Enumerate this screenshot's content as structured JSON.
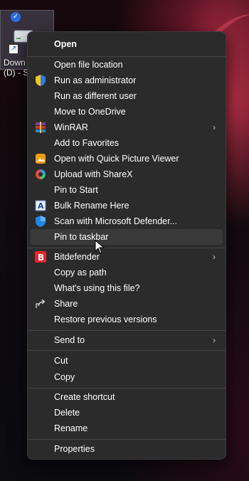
{
  "desktop": {
    "icon_label_line1": "Down",
    "icon_label_line2": "(D) - Sh"
  },
  "menu": {
    "items": [
      {
        "label": "Open",
        "icon": "",
        "bold": true
      },
      {
        "label": "Open file location",
        "icon": ""
      },
      {
        "label": "Run as administrator",
        "icon": "uac-shield-icon"
      },
      {
        "label": "Run as different user",
        "icon": ""
      },
      {
        "label": "Move to OneDrive",
        "icon": ""
      },
      {
        "label": "WinRAR",
        "icon": "winrar-icon",
        "submenu": true
      },
      {
        "label": "Add to Favorites",
        "icon": ""
      },
      {
        "label": "Open with Quick Picture Viewer",
        "icon": "quick-picture-viewer-icon"
      },
      {
        "label": "Upload with ShareX",
        "icon": "sharex-icon"
      },
      {
        "label": "Pin to Start",
        "icon": ""
      },
      {
        "label": "Bulk Rename Here",
        "icon": "bulk-rename-icon"
      },
      {
        "label": "Scan with Microsoft Defender...",
        "icon": "defender-icon"
      },
      {
        "label": "Pin to taskbar",
        "icon": "",
        "hover": true
      },
      {
        "label": "Bitdefender",
        "icon": "bitdefender-icon",
        "submenu": true
      },
      {
        "label": "Copy as path",
        "icon": ""
      },
      {
        "label": "What's using this file?",
        "icon": ""
      },
      {
        "label": "Share",
        "icon": "share-icon"
      },
      {
        "label": "Restore previous versions",
        "icon": ""
      },
      {
        "label": "Send to",
        "icon": "",
        "submenu": true
      },
      {
        "label": "Cut",
        "icon": ""
      },
      {
        "label": "Copy",
        "icon": ""
      },
      {
        "label": "Create shortcut",
        "icon": ""
      },
      {
        "label": "Delete",
        "icon": ""
      },
      {
        "label": "Rename",
        "icon": ""
      },
      {
        "label": "Properties",
        "icon": ""
      }
    ]
  },
  "colors": {
    "menu_bg": "#2b2b2b",
    "hover_bg": "#3a3a3a",
    "text": "#ffffff"
  }
}
